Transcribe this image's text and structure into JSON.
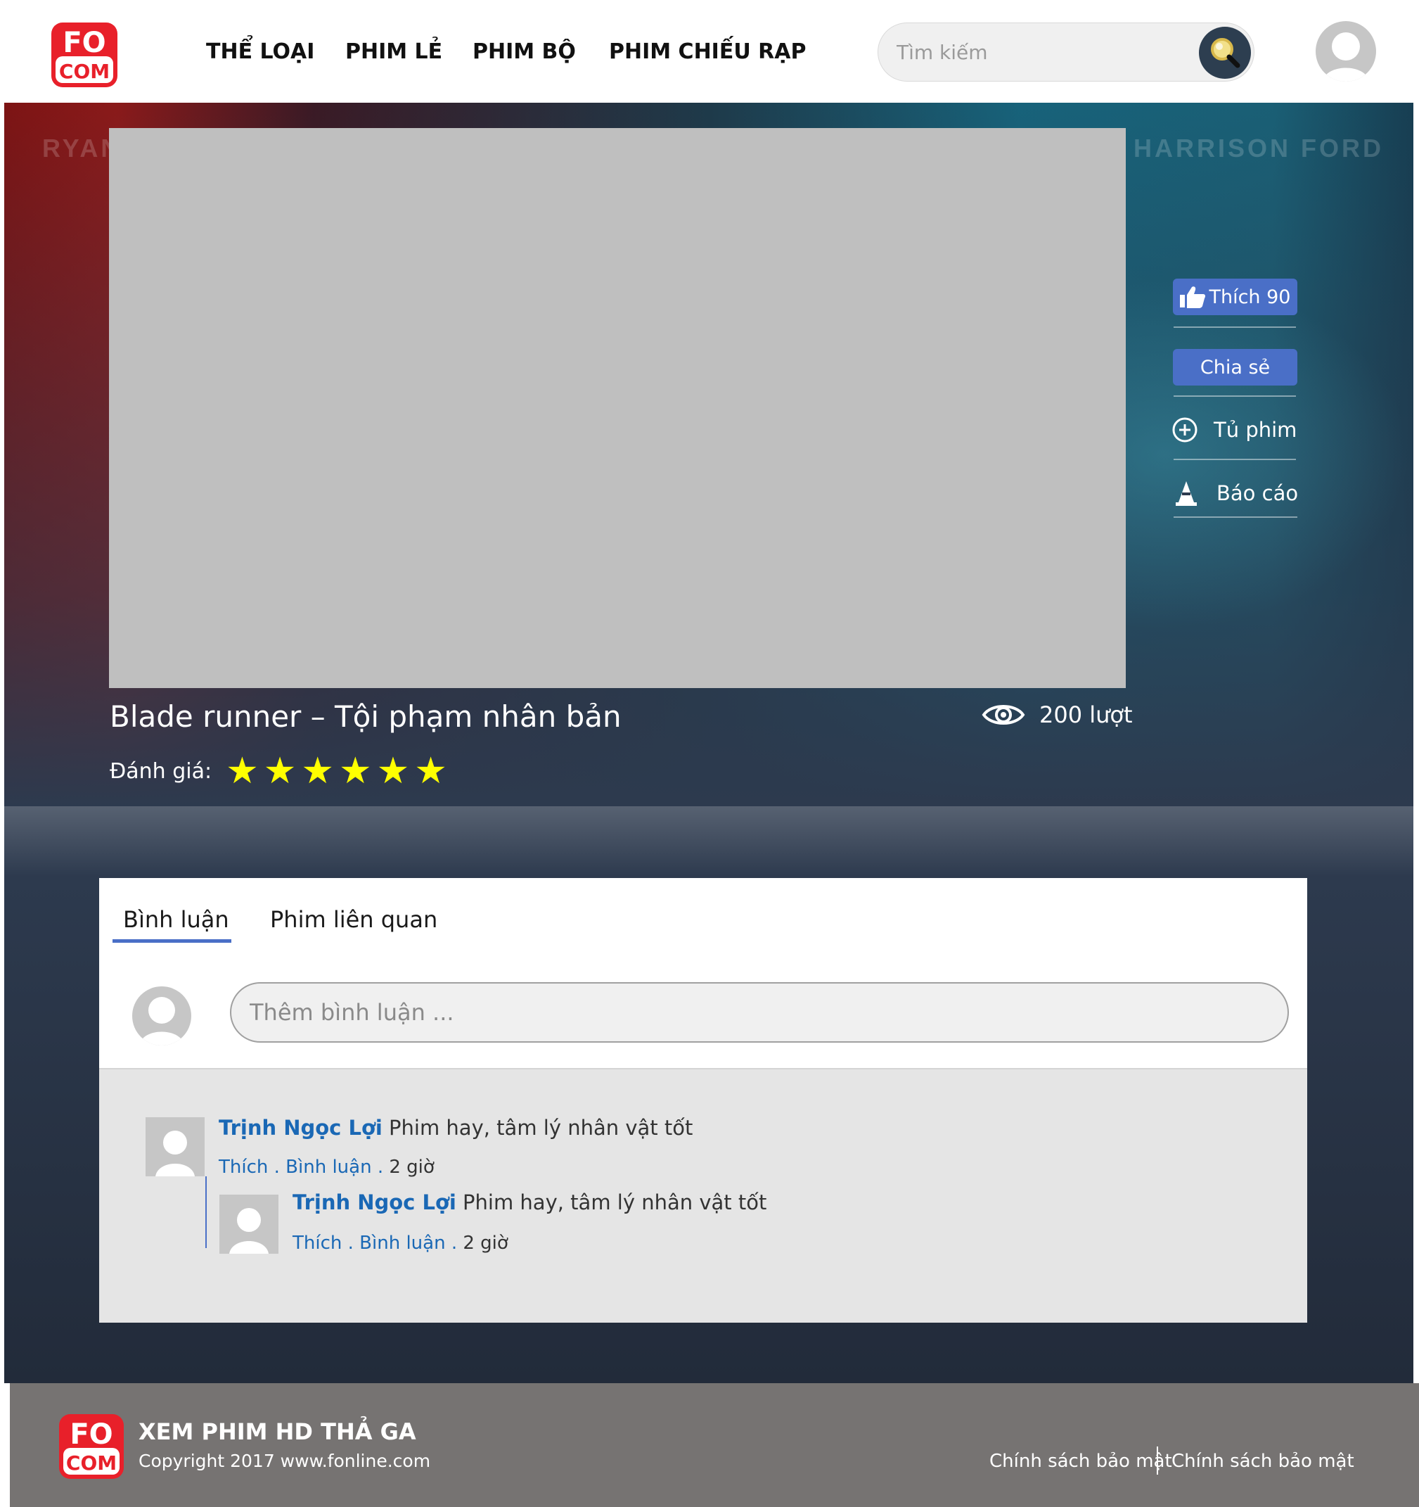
{
  "header": {
    "logo_text_top": "FO",
    "logo_text_bottom": "COM",
    "nav": [
      "THỂ LOẠI",
      "PHIM LẺ",
      "PHIM BỘ",
      "PHIM CHIẾU RẠP"
    ],
    "search_placeholder": "Tìm kiếm"
  },
  "hero": {
    "poster_text_left": "RYAN",
    "poster_text_right": "HARRISON FORD",
    "like_label": "Thích 90",
    "share_label": "Chia sẻ",
    "collection_label": "Tủ phim",
    "report_label": "Báo cáo",
    "title": "Blade runner – Tội phạm nhân bản",
    "views_label": "200 lượt",
    "rating_label": "Đánh giá:",
    "rating_stars": 6
  },
  "comments": {
    "tabs": [
      "Bình luận",
      "Phim liên quan"
    ],
    "input_placeholder": "Thêm bình luận ...",
    "items": [
      {
        "author": "Trịnh Ngọc Lợi",
        "text": "Phim hay, tâm lý nhân vật tốt",
        "like": "Thích",
        "reply": "Bình luận",
        "sep": " . ",
        "time": "2 giờ"
      },
      {
        "author": "Trịnh Ngọc Lợi",
        "text": "Phim hay, tâm lý nhân vật tốt",
        "like": "Thích",
        "reply": "Bình luận",
        "sep": " . ",
        "time": "2 giờ"
      }
    ]
  },
  "footer": {
    "title": "XEM PHIM HD THẢ GA",
    "copyright": "Copyright 2017 www.fonline.com",
    "links": [
      "Chính sách bảo mật",
      "Chính sách bảo mật"
    ]
  },
  "colors": {
    "accent": "#4a6fc7",
    "author": "#1a68b5",
    "brand_red": "#e8202a",
    "star": "#ffff00",
    "footer_bg": "#767372"
  }
}
